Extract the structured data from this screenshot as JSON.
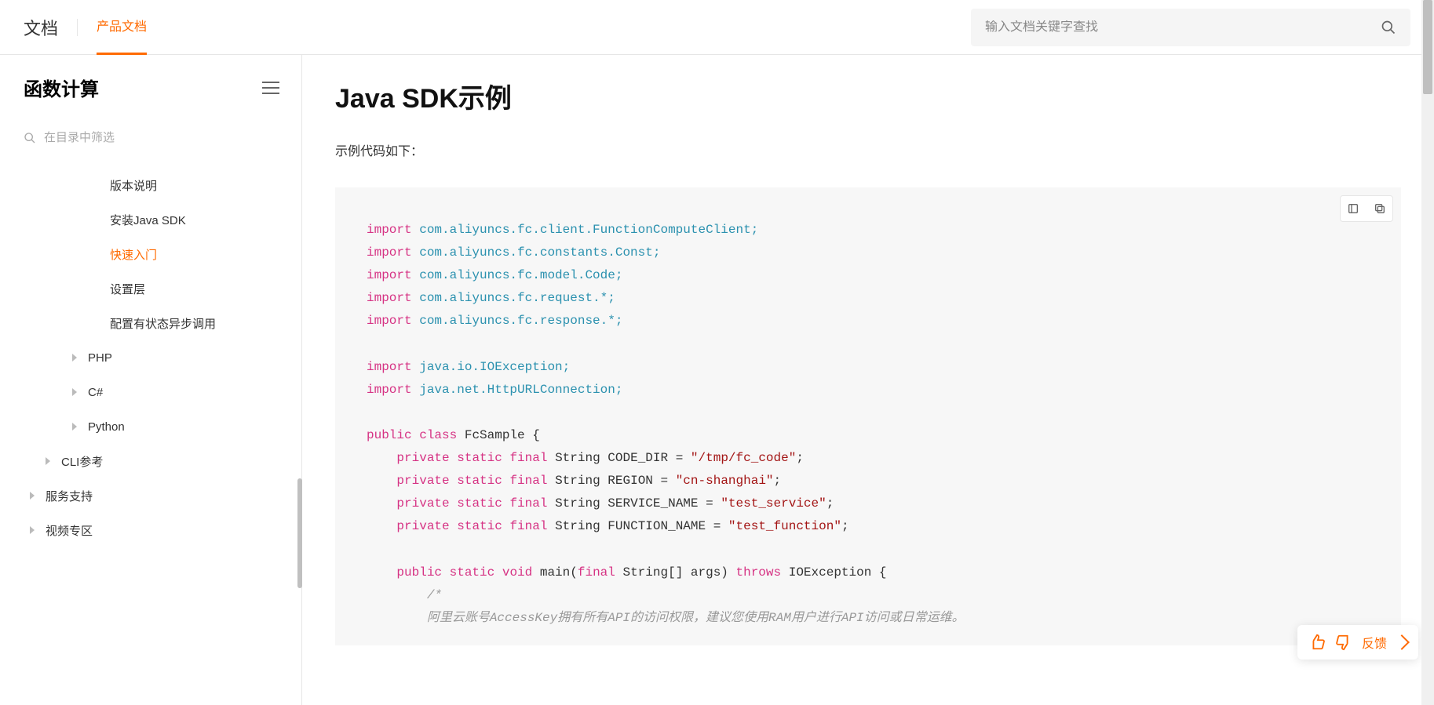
{
  "header": {
    "brand": "文档",
    "active_tab": "产品文档",
    "search_placeholder": "输入文档关键字查找"
  },
  "sidebar": {
    "title": "函数计算",
    "filter_placeholder": "在目录中筛选",
    "items": [
      {
        "label": "版本说明",
        "level": 3,
        "caret": false,
        "active": false
      },
      {
        "label": "安装Java SDK",
        "level": 3,
        "caret": false,
        "active": false
      },
      {
        "label": "快速入门",
        "level": 3,
        "caret": false,
        "active": true
      },
      {
        "label": "设置层",
        "level": 3,
        "caret": false,
        "active": false
      },
      {
        "label": "配置有状态异步调用",
        "level": 3,
        "caret": false,
        "active": false
      },
      {
        "label": "PHP",
        "level": 2,
        "caret": true,
        "active": false
      },
      {
        "label": "C#",
        "level": 2,
        "caret": true,
        "active": false
      },
      {
        "label": "Python",
        "level": 2,
        "caret": true,
        "active": false
      },
      {
        "label": "CLI参考",
        "level": 1,
        "caret": true,
        "active": false
      },
      {
        "label": "服务支持",
        "level": 0,
        "caret": true,
        "active": false
      },
      {
        "label": "视频专区",
        "level": 0,
        "caret": true,
        "active": false
      }
    ]
  },
  "content": {
    "title": "Java SDK示例",
    "intro": "示例代码如下：",
    "code": {
      "lines": [
        {
          "t": "import",
          "cls": "key"
        },
        {
          "t": " com.aliyuncs.fc.client.FunctionComputeClient;",
          "cls": "teal"
        },
        {
          "br": 1
        },
        {
          "t": "import",
          "cls": "key"
        },
        {
          "t": " com.aliyuncs.fc.constants.Const;",
          "cls": "teal"
        },
        {
          "br": 1
        },
        {
          "t": "import",
          "cls": "key"
        },
        {
          "t": " com.aliyuncs.fc.model.Code;",
          "cls": "teal"
        },
        {
          "br": 1
        },
        {
          "t": "import",
          "cls": "key"
        },
        {
          "t": " com.aliyuncs.fc.request.*;",
          "cls": "teal"
        },
        {
          "br": 1
        },
        {
          "t": "import",
          "cls": "key"
        },
        {
          "t": " com.aliyuncs.fc.response.*;",
          "cls": "teal"
        },
        {
          "br": 1
        },
        {
          "br": 1
        },
        {
          "t": "import",
          "cls": "key"
        },
        {
          "t": " java.io.IOException;",
          "cls": "teal"
        },
        {
          "br": 1
        },
        {
          "t": "import",
          "cls": "key"
        },
        {
          "t": " java.net.HttpURLConnection;",
          "cls": "teal"
        },
        {
          "br": 1
        },
        {
          "br": 1
        },
        {
          "t": "public",
          "cls": "key"
        },
        {
          "t": " ",
          "cls": "plain"
        },
        {
          "t": "class",
          "cls": "key"
        },
        {
          "t": " FcSample {",
          "cls": "plain"
        },
        {
          "br": 1
        },
        {
          "t": "    ",
          "cls": "plain"
        },
        {
          "t": "private",
          "cls": "key"
        },
        {
          "t": " ",
          "cls": "plain"
        },
        {
          "t": "static",
          "cls": "key"
        },
        {
          "t": " ",
          "cls": "plain"
        },
        {
          "t": "final",
          "cls": "key"
        },
        {
          "t": " String CODE_DIR = ",
          "cls": "plain"
        },
        {
          "t": "\"/tmp/fc_code\"",
          "cls": "str"
        },
        {
          "t": ";",
          "cls": "plain"
        },
        {
          "br": 1
        },
        {
          "t": "    ",
          "cls": "plain"
        },
        {
          "t": "private",
          "cls": "key"
        },
        {
          "t": " ",
          "cls": "plain"
        },
        {
          "t": "static",
          "cls": "key"
        },
        {
          "t": " ",
          "cls": "plain"
        },
        {
          "t": "final",
          "cls": "key"
        },
        {
          "t": " String REGION = ",
          "cls": "plain"
        },
        {
          "t": "\"cn-shanghai\"",
          "cls": "str"
        },
        {
          "t": ";",
          "cls": "plain"
        },
        {
          "br": 1
        },
        {
          "t": "    ",
          "cls": "plain"
        },
        {
          "t": "private",
          "cls": "key"
        },
        {
          "t": " ",
          "cls": "plain"
        },
        {
          "t": "static",
          "cls": "key"
        },
        {
          "t": " ",
          "cls": "plain"
        },
        {
          "t": "final",
          "cls": "key"
        },
        {
          "t": " String SERVICE_NAME = ",
          "cls": "plain"
        },
        {
          "t": "\"test_service\"",
          "cls": "str"
        },
        {
          "t": ";",
          "cls": "plain"
        },
        {
          "br": 1
        },
        {
          "t": "    ",
          "cls": "plain"
        },
        {
          "t": "private",
          "cls": "key"
        },
        {
          "t": " ",
          "cls": "plain"
        },
        {
          "t": "static",
          "cls": "key"
        },
        {
          "t": " ",
          "cls": "plain"
        },
        {
          "t": "final",
          "cls": "key"
        },
        {
          "t": " String FUNCTION_NAME = ",
          "cls": "plain"
        },
        {
          "t": "\"test_function\"",
          "cls": "str"
        },
        {
          "t": ";",
          "cls": "plain"
        },
        {
          "br": 1
        },
        {
          "br": 1
        },
        {
          "t": "    ",
          "cls": "plain"
        },
        {
          "t": "public",
          "cls": "key"
        },
        {
          "t": " ",
          "cls": "plain"
        },
        {
          "t": "static",
          "cls": "key"
        },
        {
          "t": " ",
          "cls": "plain"
        },
        {
          "t": "void",
          "cls": "key"
        },
        {
          "t": " main(",
          "cls": "plain"
        },
        {
          "t": "final",
          "cls": "key"
        },
        {
          "t": " String[] args) ",
          "cls": "plain"
        },
        {
          "t": "throws",
          "cls": "key"
        },
        {
          "t": " IOException {",
          "cls": "plain"
        },
        {
          "br": 1
        },
        {
          "t": "        /*",
          "cls": "comm"
        },
        {
          "br": 1
        },
        {
          "t": "        阿里云账号AccessKey拥有所有API的访问权限，建议您使用RAM用户进行API访问或日常运维。",
          "cls": "comm"
        }
      ]
    }
  },
  "feedback": {
    "label": "反馈"
  }
}
